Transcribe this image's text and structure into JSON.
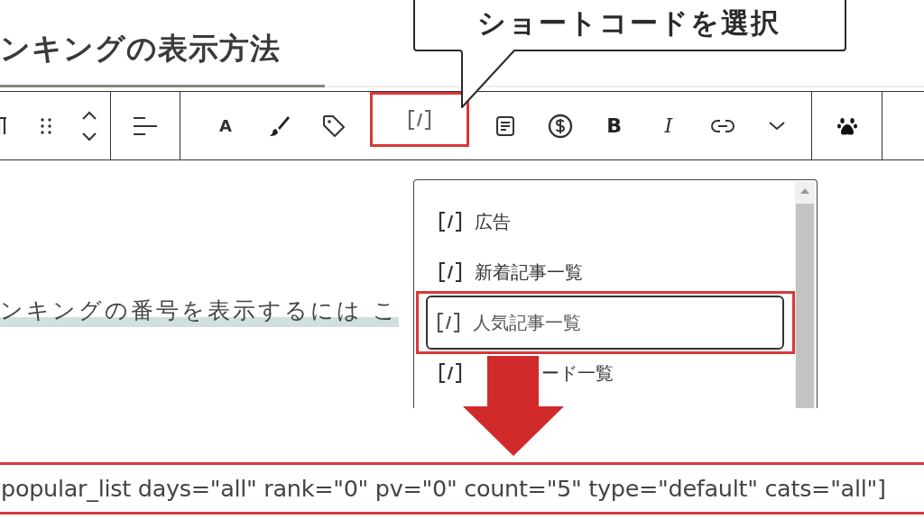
{
  "heading": "ンキングの表示方法",
  "callout": "ショートコードを選択",
  "toolbar": {
    "groups": [
      {
        "tools": [
          {
            "kind": "paragraph"
          },
          {
            "kind": "drag"
          },
          {
            "kind": "move"
          }
        ]
      },
      {
        "tools": [
          {
            "kind": "align"
          }
        ]
      },
      {
        "tools": [
          {
            "kind": "letter",
            "label": "A"
          },
          {
            "kind": "brush"
          },
          {
            "kind": "tag"
          },
          {
            "kind": "shortcode",
            "highlighted": true
          },
          {
            "kind": "document"
          },
          {
            "kind": "dollar"
          },
          {
            "kind": "bold",
            "label": "B"
          },
          {
            "kind": "italic",
            "label": "I"
          },
          {
            "kind": "link"
          },
          {
            "kind": "more"
          }
        ]
      },
      {
        "tools": [
          {
            "kind": "paw"
          }
        ]
      }
    ]
  },
  "paragraph": "ンキングの番号を表示するには こ",
  "menu": {
    "items": [
      {
        "label": "広告",
        "selected": false
      },
      {
        "label": "新着記事一覧",
        "selected": false
      },
      {
        "label": "人気記事一覧",
        "selected": true
      },
      {
        "label": "ード一覧",
        "selected": false
      }
    ]
  },
  "code": "popular_list days=\"all\" rank=\"0\" pv=\"0\" count=\"5\" type=\"default\" cats=\"all\"]"
}
